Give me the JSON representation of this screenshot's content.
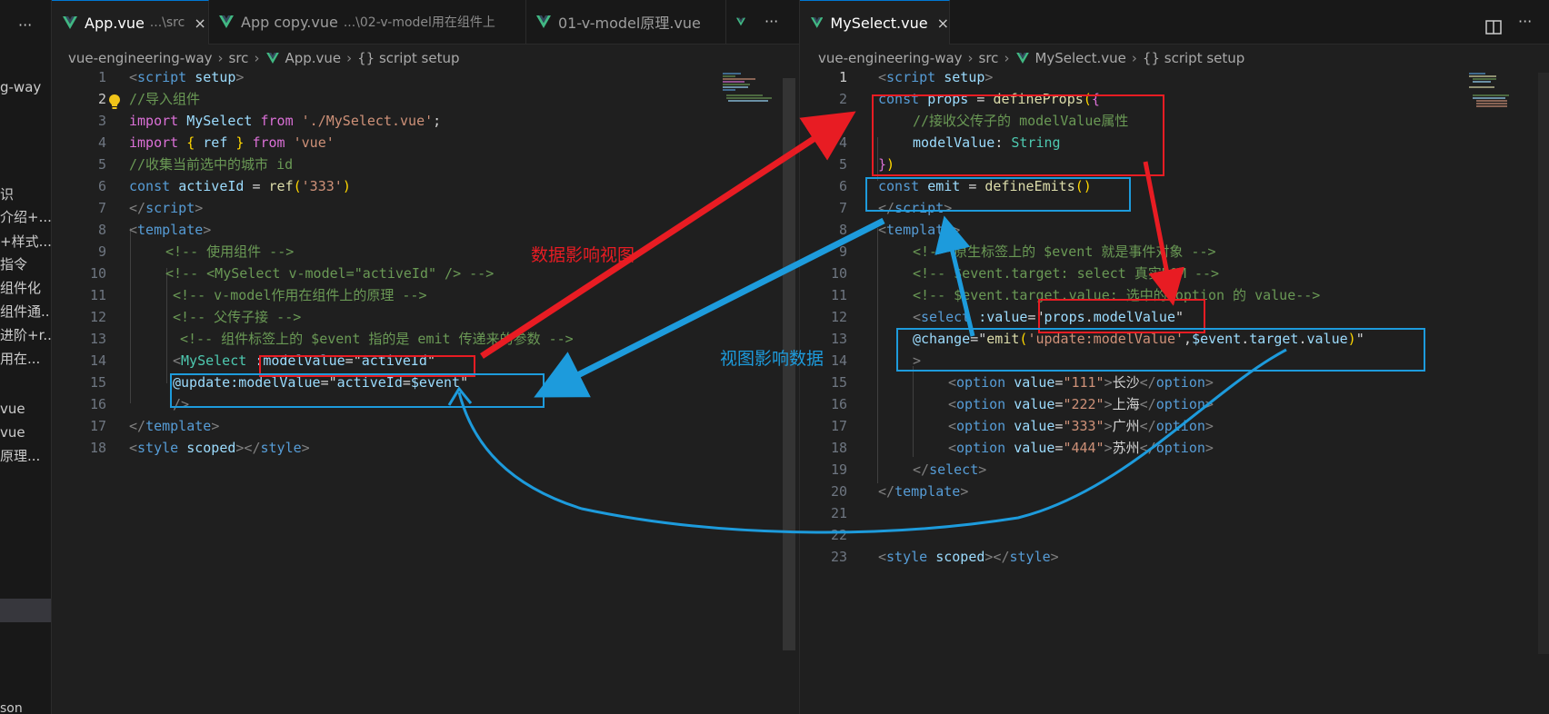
{
  "explorer": {
    "more_icon": "ellipsis-icon",
    "items": [
      "g-way",
      "识",
      "介绍+...",
      "+样式...",
      "指令",
      "组件化",
      "组件通...",
      "进阶+r...",
      "用在...",
      "vue",
      "vue",
      "原理..."
    ],
    "bottom_item": "son"
  },
  "left_editor": {
    "tabs": [
      {
        "name": "App.vue",
        "desc": "...\\src",
        "close": "×"
      },
      {
        "name": "App copy.vue",
        "desc": "...\\02-v-model用在组件上"
      },
      {
        "name": "01-v-model原理.vue",
        "desc": ""
      }
    ],
    "more_label": "···",
    "breadcrumb": [
      "vue-engineering-way",
      "src",
      "App.vue",
      "{} script setup"
    ]
  },
  "right_editor": {
    "tab": {
      "name": "MySelect.vue",
      "close": "×"
    },
    "split_icon": "split-editor-icon",
    "more_label": "···",
    "breadcrumb": [
      "vue-engineering-way",
      "src",
      "MySelect.vue",
      "{} script setup"
    ]
  },
  "annotations": {
    "red_label": "数据影响视图",
    "blue_label": "视图影响数据",
    "red_color": "#e81c23",
    "blue_color": "#1d9bdc"
  },
  "colors": {
    "editor_bg": "#1f1f1f",
    "tab_accent": "#0078d4",
    "vue_green": "#41b883"
  }
}
